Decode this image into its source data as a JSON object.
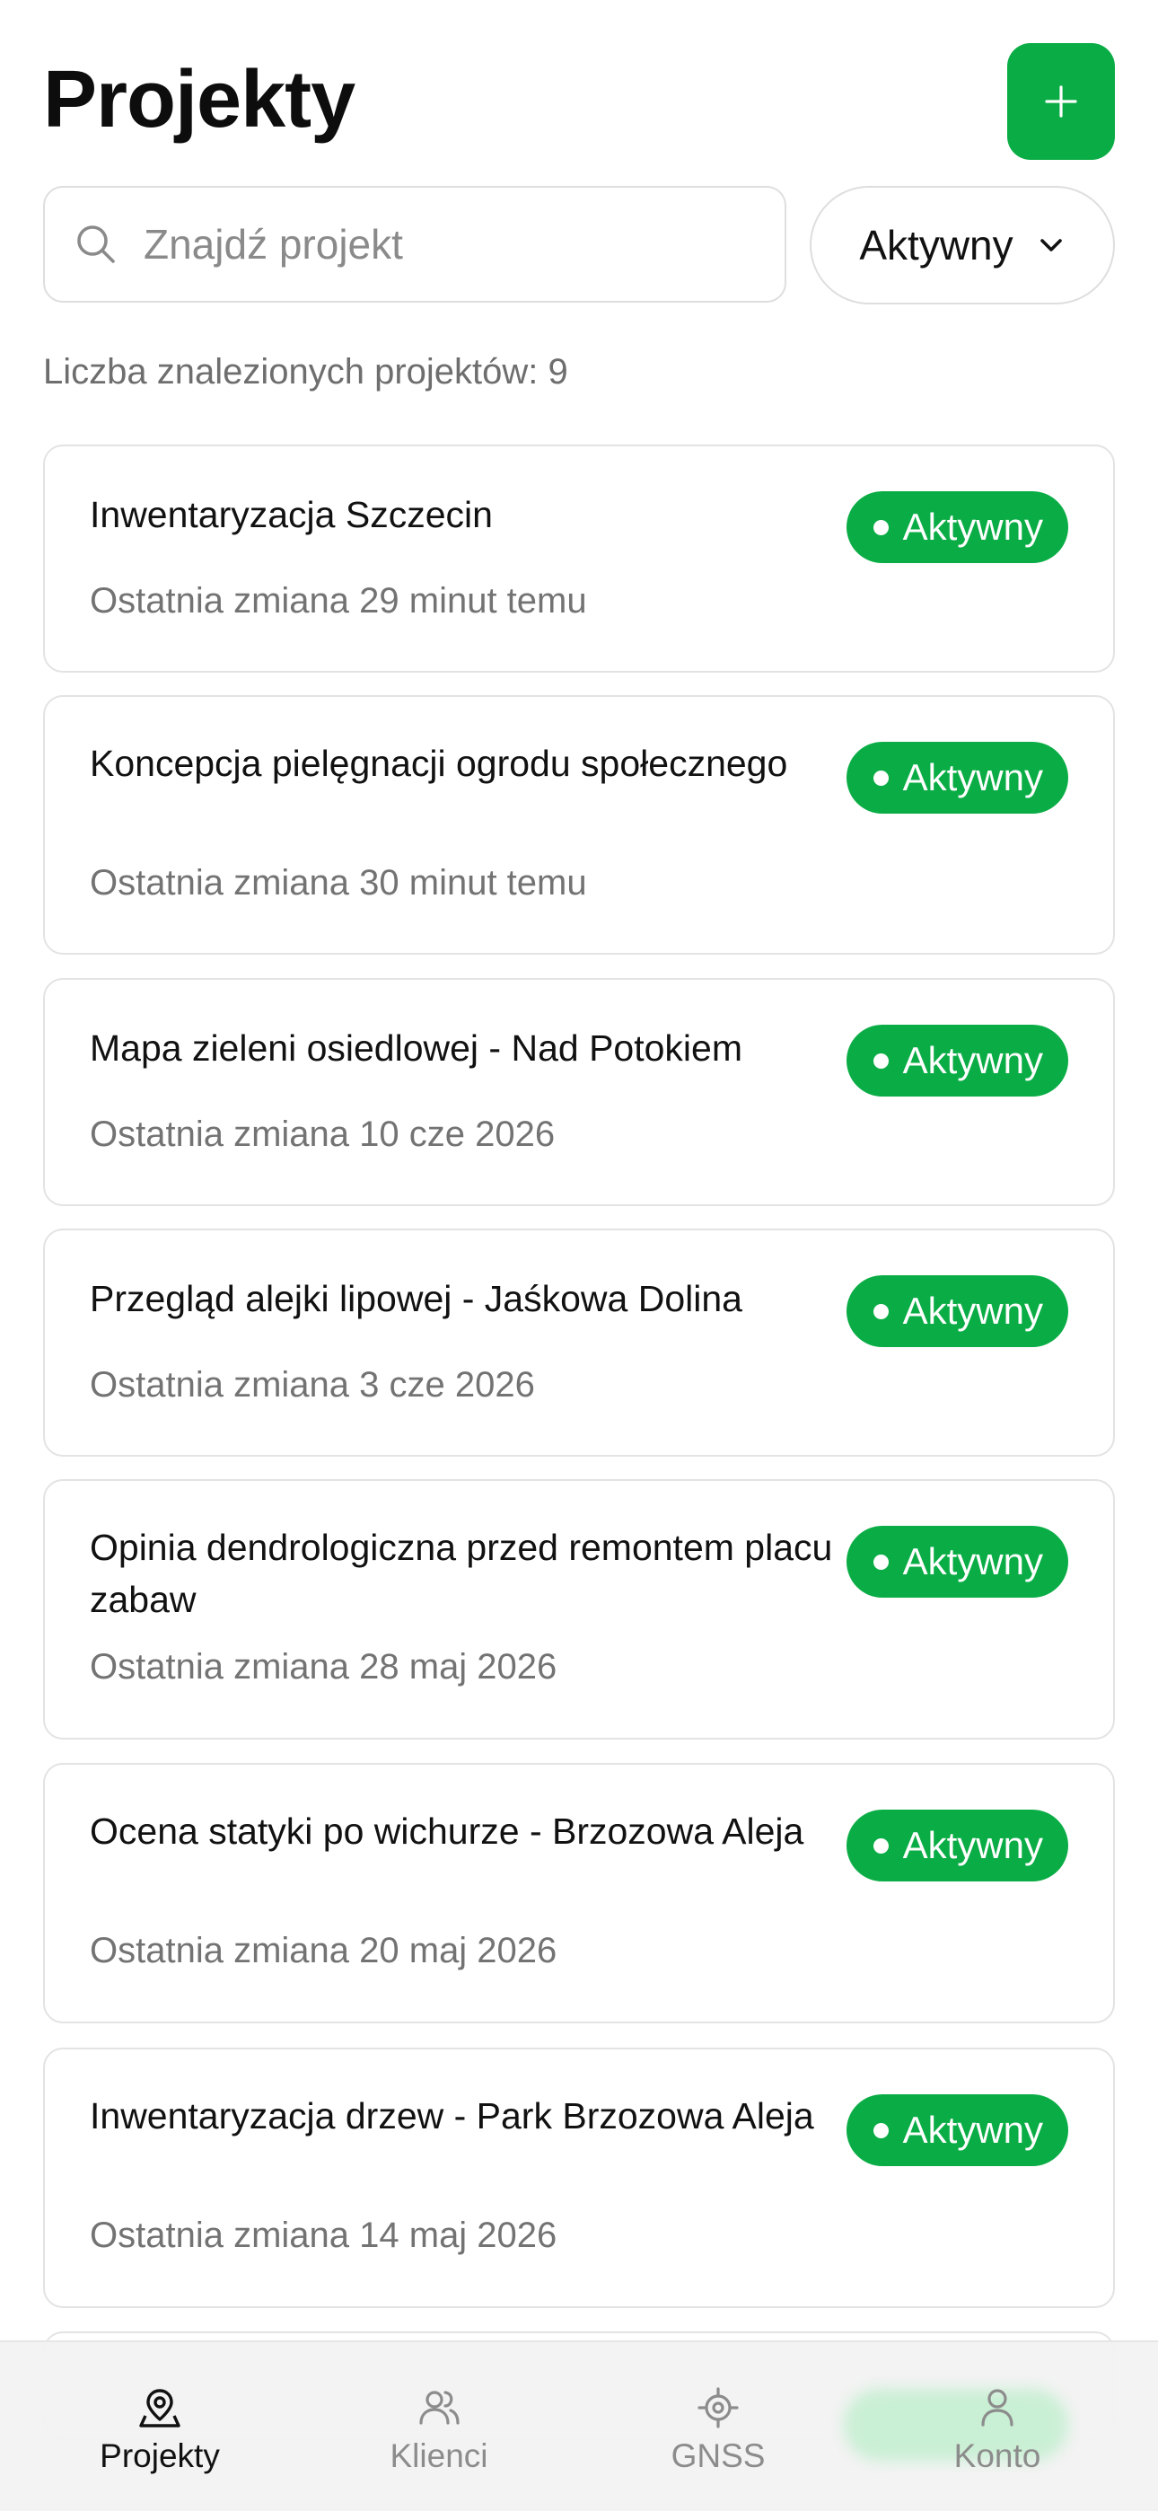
{
  "header": {
    "title": "Projekty",
    "add_button_icon": "plus-icon"
  },
  "search": {
    "placeholder": "Znajdź projekt",
    "value": "",
    "icon": "search-icon"
  },
  "status_filter": {
    "selected": "Aktywny",
    "icon": "chevron-down-icon"
  },
  "result_count": "Liczba znalezionych projektów: 9",
  "projects": [
    {
      "title": "Inwentaryzacja Szczecin",
      "last_change": "Ostatnia zmiana 29 minut temu",
      "status": "Aktywny"
    },
    {
      "title": "Koncepcja pielęgnacji ogrodu społecznego",
      "last_change": "Ostatnia zmiana 30 minut temu",
      "status": "Aktywny"
    },
    {
      "title": "Mapa zieleni osiedlowej - Nad Potokiem",
      "last_change": "Ostatnia zmiana 10 cze 2026",
      "status": "Aktywny"
    },
    {
      "title": "Przegląd alejki lipowej - Jaśkowa Dolina",
      "last_change": "Ostatnia zmiana 3 cze 2026",
      "status": "Aktywny"
    },
    {
      "title": "Opinia dendrologiczna przed remontem placu zabaw",
      "last_change": "Ostatnia zmiana 28 maj 2026",
      "status": "Aktywny"
    },
    {
      "title": "Ocena statyki po wichurze - Brzozowa Aleja",
      "last_change": "Ostatnia zmiana 20 maj 2026",
      "status": "Aktywny"
    },
    {
      "title": "Inwentaryzacja drzew - Park Brzozowa Aleja",
      "last_change": "Ostatnia zmiana 14 maj 2026",
      "status": "Aktywny"
    }
  ],
  "bottom_nav": [
    {
      "label": "Projekty",
      "icon": "map-pin-icon",
      "active": true
    },
    {
      "label": "Klienci",
      "icon": "users-icon",
      "active": false
    },
    {
      "label": "GNSS",
      "icon": "crosshair-icon",
      "active": false
    },
    {
      "label": "Konto",
      "icon": "user-icon",
      "active": false
    }
  ],
  "colors": {
    "accent": "#0aad45",
    "muted_text": "#737373",
    "border": "#e3e3e3"
  }
}
